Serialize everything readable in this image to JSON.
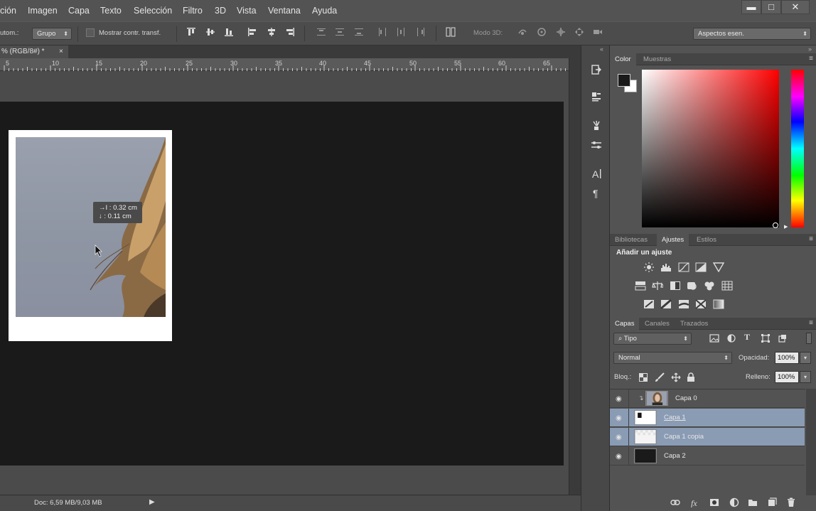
{
  "menubar": {
    "items": [
      "ción",
      "Imagen",
      "Capa",
      "Texto",
      "Selección",
      "Filtro",
      "3D",
      "Vista",
      "Ventana",
      "Ayuda"
    ],
    "window_controls": {
      "minimize": "▬",
      "restore": "□",
      "close": "✕"
    }
  },
  "options_bar": {
    "autom_label": "utom.:",
    "group_value": "Grupo",
    "show_transform_label": "Mostrar contr. transf.",
    "mode3d_label": "Modo 3D:",
    "workspace_value": "Aspectos esen."
  },
  "document": {
    "tab_title": "% (RGB/8#) *",
    "tab_close": "×",
    "ruler_labels": [
      "5",
      "10",
      "15",
      "20",
      "25",
      "30",
      "35",
      "40",
      "45",
      "50",
      "55",
      "60",
      "65"
    ],
    "status_text": "Doc: 6,59 MB/9,03 MB",
    "status_arrow": "▶"
  },
  "tooltip": {
    "line1_icon": "→I :",
    "line1_value": "0.32 cm",
    "line2_icon": "↓ :",
    "line2_value": "0.11 cm"
  },
  "color_panel": {
    "tabs": [
      "Color",
      "Muestras"
    ],
    "foreground": "#1a1a1a",
    "background": "#ffffff",
    "hue": "#ff0000"
  },
  "adjustments_panel": {
    "tabs": [
      "Bibliotecas",
      "Ajustes",
      "Estilos"
    ],
    "heading": "Añadir un ajuste",
    "row1_icons": [
      "brightness-icon",
      "levels-icon",
      "curves-icon",
      "exposure-icon",
      "vibrance-icon"
    ],
    "row2_icons": [
      "hue-saturation-icon",
      "color-balance-icon",
      "black-white-icon",
      "photo-filter-icon",
      "channel-mixer-icon",
      "color-lookup-icon"
    ],
    "row3_icons": [
      "invert-icon",
      "posterize-icon",
      "threshold-icon",
      "selective-color-icon",
      "gradient-map-icon"
    ]
  },
  "layers_panel": {
    "tabs": [
      "Capas",
      "Canales",
      "Trazados"
    ],
    "filter_value": "Tipo",
    "blend_mode": "Normal",
    "opacity_label": "Opacidad:",
    "opacity_value": "100%",
    "lock_label": "Bloq.:",
    "fill_label": "Relleno:",
    "fill_value": "100%",
    "layers": [
      {
        "name": "Capa 0",
        "selected": false
      },
      {
        "name": "Capa 1",
        "selected": true
      },
      {
        "name": "Capa 1 copia",
        "selected": true
      },
      {
        "name": "Capa 2",
        "selected": false
      }
    ]
  },
  "colors": {
    "selection": "#8a9bb4",
    "canvas": "#1b1a1b"
  }
}
